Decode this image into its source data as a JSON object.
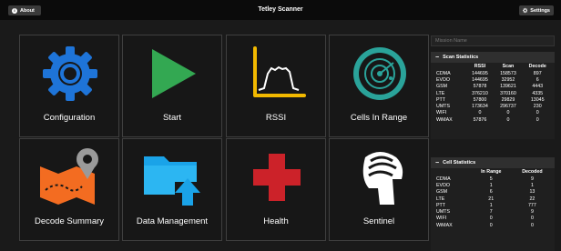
{
  "header": {
    "about_label": "About",
    "title": "Tetley Scanner",
    "settings_label": "Settings"
  },
  "tiles": [
    {
      "label": "Configuration",
      "icon": "gear-icon",
      "color": "#1e74d8"
    },
    {
      "label": "Start",
      "icon": "play-icon",
      "color": "#33a852"
    },
    {
      "label": "RSSI",
      "icon": "rssi-chart-icon",
      "color": "#f2b900"
    },
    {
      "label": "Cells In Range",
      "icon": "radar-icon",
      "color": "#2aa39a"
    },
    {
      "label": "Decode Summary",
      "icon": "map-pin-icon",
      "color": "#f36c21"
    },
    {
      "label": "Data Management",
      "icon": "folder-upload-icon",
      "color": "#1aa3e8"
    },
    {
      "label": "Health",
      "icon": "cross-icon",
      "color": "#cc2229"
    },
    {
      "label": "Sentinel",
      "icon": "sentinel-helmet-icon",
      "color": "#ffffff"
    }
  ],
  "search": {
    "placeholder": "Mission Name"
  },
  "scan_statistics": {
    "title": "Scan Statistics",
    "columns": [
      "",
      "RSSI",
      "Scan",
      "Decode"
    ],
    "rows": [
      [
        "CDMA",
        "144695",
        "158573",
        "897"
      ],
      [
        "EVDO",
        "144695",
        "32952",
        "6"
      ],
      [
        "GSM",
        "57878",
        "139621",
        "4443"
      ],
      [
        "LTE",
        "376210",
        "370160",
        "4335"
      ],
      [
        "PTT",
        "57800",
        "29829",
        "13045"
      ],
      [
        "UMTS",
        "173634",
        "296737",
        "230"
      ],
      [
        "WIFI",
        "0",
        "0",
        "0"
      ],
      [
        "WiMAX",
        "57876",
        "0",
        "0"
      ]
    ]
  },
  "cell_statistics": {
    "title": "Cell Statistics",
    "columns": [
      "",
      "In Range",
      "Decoded"
    ],
    "rows": [
      [
        "CDMA",
        "5",
        "9"
      ],
      [
        "EVDO",
        "1",
        "1"
      ],
      [
        "GSM",
        "6",
        "13"
      ],
      [
        "LTE",
        "21",
        "22"
      ],
      [
        "PTT",
        "1",
        "777"
      ],
      [
        "UMTS",
        "7",
        "9"
      ],
      [
        "WIFI",
        "0",
        "0"
      ],
      [
        "WiMAX",
        "0",
        "0"
      ]
    ]
  }
}
